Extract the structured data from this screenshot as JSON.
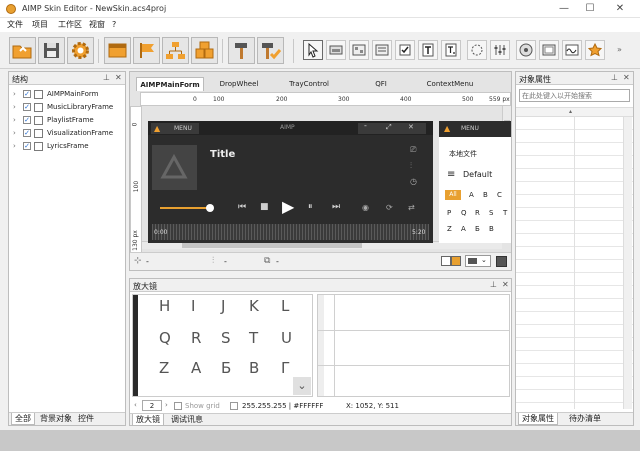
{
  "window": {
    "title": "AIMP Skin Editor - NewSkin.acs4proj",
    "minimize": "—",
    "maximize": "☐",
    "close": "✕"
  },
  "menu": [
    "文件",
    "项目",
    "工作区",
    "视窗",
    "?"
  ],
  "structure_panel": {
    "title": "结构",
    "items": [
      "AIMPMainForm",
      "MusicLibraryFrame",
      "PlaylistFrame",
      "VisualizationFrame",
      "LyricsFrame"
    ],
    "bottom_tabs": [
      "全部",
      "背景对象",
      "控件"
    ]
  },
  "designer": {
    "tabs": [
      "AIMPMainForm",
      "DropWheel",
      "TrayControl",
      "QFI",
      "ContextMenu"
    ],
    "ruler_h": [
      "0",
      "100",
      "200",
      "300",
      "400",
      "500",
      "559 px"
    ],
    "ruler_v": [
      "0",
      "100",
      "130 px"
    ],
    "skin_preview": {
      "menu_label": "MENU",
      "app_name": "AIMP",
      "track_title": "Title",
      "time_start": "0:00",
      "time_end": "5:20",
      "side_menu_label": "MENU",
      "side_tab": "本地文件",
      "playlist_name": "Default",
      "alpha_all": "All",
      "alphabet": [
        "A",
        "B",
        "C",
        "P",
        "Q",
        "R",
        "S",
        "T",
        "Z",
        "A",
        "Б",
        "B"
      ]
    },
    "bottom_bar": {
      "snap_label": "-",
      "align_label": "-",
      "copy_label": "-"
    }
  },
  "magnifier": {
    "title": "放大镜",
    "rows": [
      [
        "H",
        "I",
        "J",
        "K",
        "L"
      ],
      [
        "Q",
        "R",
        "S",
        "T",
        "U"
      ],
      [
        "Z",
        "A",
        "Б",
        "B",
        "Г"
      ]
    ],
    "zoom": "2",
    "show_grid": "Show grid",
    "color": "255.255.255 | #FFFFFF",
    "coords": "X: 1052, Y: 511",
    "bottom_tabs": [
      "放大镜",
      "调试讯息"
    ]
  },
  "props_panel": {
    "title": "对象属性",
    "search_placeholder": "在此处键入以开始搜索",
    "bottom_tabs": [
      "对象属性",
      "待办清单"
    ]
  }
}
